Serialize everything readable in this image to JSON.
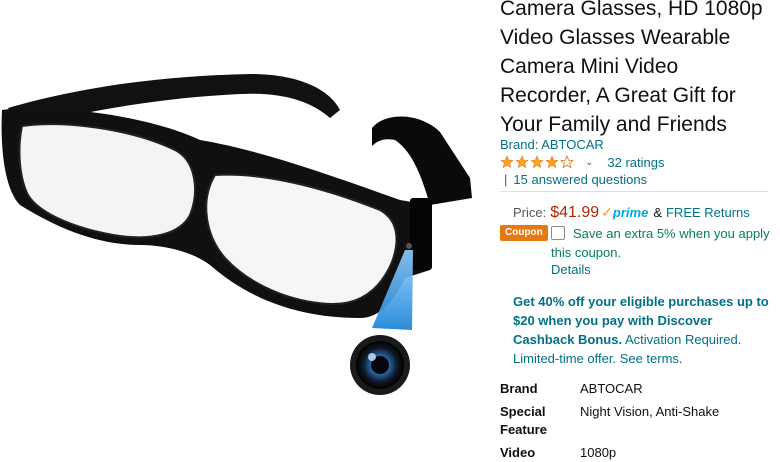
{
  "product": {
    "title": "Camera Glasses, HD 1080p Video Glasses Wearable Camera Mini Video Recorder, A Great Gift for Your Family and Friends",
    "brand_label": "Brand: ABTOCAR",
    "rating_stars": 4.0,
    "ratings_count": "32 ratings",
    "qa_separator": "|",
    "answered_questions": "15 answered questions"
  },
  "price": {
    "label": "Price:",
    "value": "$41.99",
    "prime_check": "✓",
    "prime_word": "prime",
    "amp": "&",
    "returns": "FREE Returns"
  },
  "coupon": {
    "badge": "Coupon",
    "text": "Save an extra 5% when you apply this coupon.",
    "details": "Details"
  },
  "promo": {
    "bold": "Get 40% off your eligible purchases up to $20 when you pay with Discover Cashback Bonus.",
    "rest": " Activation Required. Limited-time offer. See terms."
  },
  "specs": [
    {
      "key": "Brand",
      "value": "ABTOCAR"
    },
    {
      "key": "Special Feature",
      "value": "Night Vision, Anti-Shake"
    },
    {
      "key": "Video",
      "value": "1080p"
    }
  ],
  "colors": {
    "link": "#007185",
    "price": "#b12704",
    "coupon_badge": "#e47911",
    "coupon_text": "#067d62",
    "star": "#ffa41c",
    "prime": "#00a8e1"
  }
}
